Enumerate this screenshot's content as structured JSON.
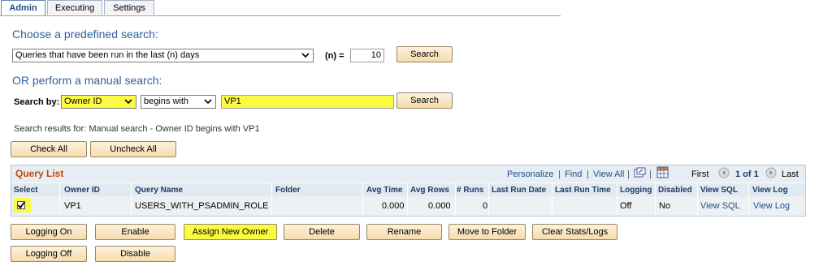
{
  "tabs": [
    {
      "label": "Admin",
      "active": true
    },
    {
      "label": "Executing",
      "active": false
    },
    {
      "label": "Settings",
      "active": false
    }
  ],
  "predefined": {
    "heading": "Choose a predefined search:",
    "selected": "Queries that have been run in the last (n) days",
    "n_label": "(n) =",
    "n_value": "10",
    "search_label": "Search"
  },
  "manual": {
    "heading": "OR perform a manual search:",
    "search_by_label": "Search by:",
    "field": "Owner ID",
    "operator": "begins with",
    "value": "VP1",
    "search_label": "Search"
  },
  "results_text": "Search results for: Manual search - Owner ID begins with VP1",
  "check_all_label": "Check All",
  "uncheck_all_label": "Uncheck All",
  "grid": {
    "title": "Query List",
    "personalize": "Personalize",
    "find": "Find",
    "view_all": "View All",
    "pager_first": "First",
    "pager_range": "1 of 1",
    "pager_last": "Last",
    "columns": [
      "Select",
      "Owner ID",
      "Query Name",
      "Folder",
      "Avg Time",
      "Avg Rows",
      "# Runs",
      "Last Run Date",
      "Last Run Time",
      "Logging",
      "Disabled",
      "View SQL",
      "View Log"
    ],
    "rows": [
      {
        "selected": true,
        "owner": "VP1",
        "query": "USERS_WITH_PSADMIN_ROLE",
        "folder": "",
        "avg_time": "0.000",
        "avg_rows": "0.000",
        "runs": "0",
        "last_date": "",
        "last_time": "",
        "logging": "Off",
        "disabled": "No",
        "view_sql": "View SQL",
        "view_log": "View Log"
      }
    ]
  },
  "actions": {
    "logging_on": "Logging On",
    "enable": "Enable",
    "assign_new_owner": "Assign New Owner",
    "delete": "Delete",
    "rename": "Rename",
    "move_to_folder": "Move to Folder",
    "clear_stats": "Clear Stats/Logs",
    "logging_off": "Logging Off",
    "disable": "Disable"
  },
  "colors": {
    "highlight": "#fbfb44",
    "link": "#1e4c8c",
    "heading": "#2f5f9c",
    "grid_title": "#c44a00"
  }
}
